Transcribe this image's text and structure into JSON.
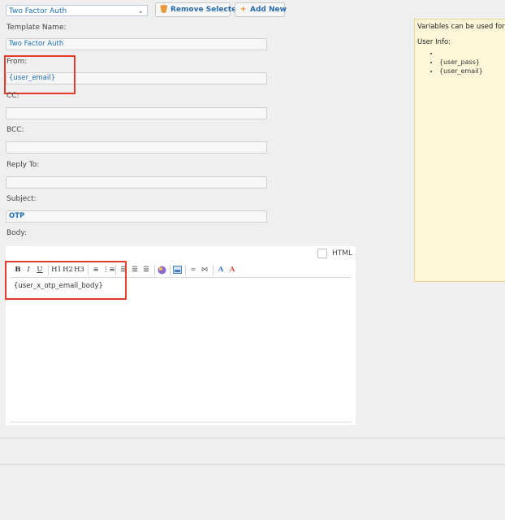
{
  "template_select": {
    "value": "Two Factor Auth"
  },
  "toolbar": {
    "remove_label": "Remove Selected",
    "add_label": "Add New"
  },
  "form": {
    "template_name": {
      "label": "Template Name:",
      "value": "Two Factor Auth"
    },
    "from": {
      "label": "From:",
      "value": "{user_email}"
    },
    "cc": {
      "label": "CC:",
      "value": ""
    },
    "bcc": {
      "label": "BCC:",
      "value": ""
    },
    "reply_to": {
      "label": "Reply To:",
      "value": ""
    },
    "subject": {
      "label": "Subject:",
      "value": "OTP"
    },
    "body": {
      "label": "Body:"
    }
  },
  "editor": {
    "html_label": "HTML",
    "buttons": [
      "B",
      "I",
      "U",
      "H1",
      "H2",
      "H3"
    ],
    "content": "{user_x_otp_email_body}"
  },
  "info": {
    "title": "Variables can be used for u",
    "section": "User Info:",
    "items": [
      "",
      "{user_pass}",
      "{user_email}"
    ]
  },
  "colors": {
    "accent": "#1f6fb5",
    "highlight": "#e53b2c",
    "info_bg": "#fdf6d8"
  }
}
